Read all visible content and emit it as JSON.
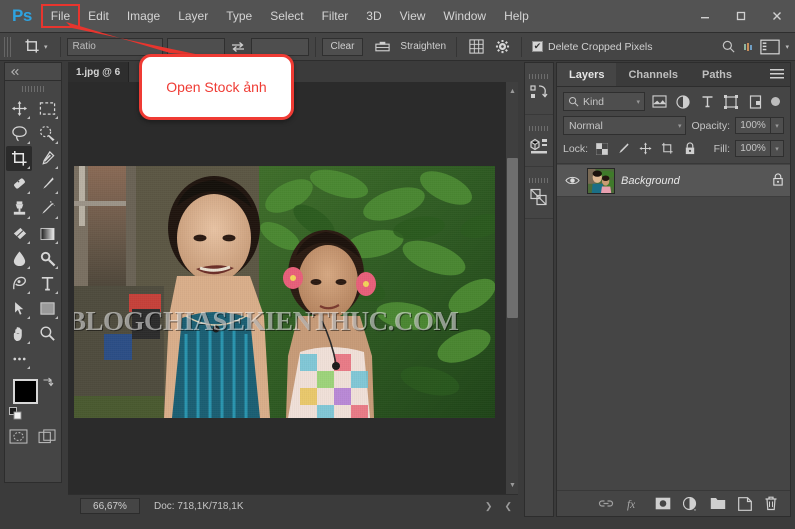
{
  "app": {
    "logo": "Ps",
    "menus": [
      "File",
      "Edit",
      "Image",
      "Layer",
      "Type",
      "Select",
      "Filter",
      "3D",
      "View",
      "Window",
      "Help"
    ],
    "highlighted_menu": "File",
    "window_buttons": [
      "minimize-button",
      "maximize-button",
      "close-button"
    ]
  },
  "options_bar": {
    "tool": "crop-tool",
    "ratio_label": "Ratio",
    "width_value": "",
    "height_value": "",
    "swap_icon": "swap-arrows-icon",
    "resolution_value": "",
    "clear_label": "Clear",
    "straighten_label": "Straighten",
    "overlay_icon": "grid-overlay-icon",
    "settings_icon": "gear-icon",
    "delete_cropped_label": "Delete Cropped Pixels",
    "delete_cropped_checked": true,
    "search_icon": "search-icon",
    "workspace_icon": "workspace-switcher-icon"
  },
  "toolbar": {
    "collapse_icon": "collapse-double-arrow-icon",
    "tools": [
      {
        "name": "move-tool",
        "active": false
      },
      {
        "name": "rectangular-marquee-tool",
        "active": false
      },
      {
        "name": "lasso-tool",
        "active": false
      },
      {
        "name": "quick-selection-tool",
        "active": false
      },
      {
        "name": "crop-tool",
        "active": true
      },
      {
        "name": "eyedropper-tool",
        "active": false
      },
      {
        "name": "spot-healing-brush-tool",
        "active": false
      },
      {
        "name": "brush-tool",
        "active": false
      },
      {
        "name": "clone-stamp-tool",
        "active": false
      },
      {
        "name": "history-brush-tool",
        "active": false
      },
      {
        "name": "eraser-tool",
        "active": false
      },
      {
        "name": "gradient-tool",
        "active": false
      },
      {
        "name": "blur-tool",
        "active": false
      },
      {
        "name": "dodge-tool",
        "active": false
      },
      {
        "name": "pen-tool",
        "active": false
      },
      {
        "name": "horizontal-type-tool",
        "active": false
      },
      {
        "name": "path-selection-tool",
        "active": false
      },
      {
        "name": "rectangle-shape-tool",
        "active": false
      },
      {
        "name": "hand-tool",
        "active": false
      },
      {
        "name": "zoom-tool",
        "active": false
      },
      {
        "name": "edit-toolbar-ellipsis",
        "active": false
      }
    ],
    "foreground_color": "#000000",
    "background_color": "#ffffff",
    "quick_mask_icon": "quick-mask-icon",
    "screen_mode_icon": "screen-mode-icon"
  },
  "document": {
    "tab_label": "1.jpg @ 6",
    "watermark": "BLOGCHIASEKIENTHUC.COM"
  },
  "status_bar": {
    "zoom": "66,67%",
    "doc_info": "Doc: 718,1K/718,1K"
  },
  "panels": {
    "collapsed_icons": [
      "history-panel-icon",
      "3d-panel-icon",
      "layer-comps-panel-icon"
    ],
    "tabs": [
      {
        "label": "Layers",
        "active": true
      },
      {
        "label": "Channels",
        "active": false
      },
      {
        "label": "Paths",
        "active": false
      }
    ],
    "menu_icon": "panel-menu-icon",
    "filter": {
      "kind_label": "Kind",
      "search_icon": "search-icon",
      "icons": [
        "pixel-layer-filter-icon",
        "adjustment-layer-filter-icon",
        "type-layer-filter-icon",
        "shape-layer-filter-icon",
        "smart-object-filter-icon"
      ],
      "toggle_icon": "filter-toggle-icon"
    },
    "blend_mode": "Normal",
    "opacity_label": "Opacity:",
    "opacity_value": "100%",
    "lock_label": "Lock:",
    "lock_icons": [
      "lock-transparent-pixels-icon",
      "lock-image-pixels-icon",
      "lock-position-icon",
      "lock-artboard-icon",
      "lock-all-icon"
    ],
    "fill_label": "Fill:",
    "fill_value": "100%",
    "layers": [
      {
        "name": "Background",
        "visible": true,
        "locked": true
      }
    ],
    "footer_icons": [
      "link-layers-icon",
      "layer-style-fx-icon",
      "add-layer-mask-icon",
      "new-adjustment-layer-icon",
      "new-group-icon",
      "new-layer-icon",
      "delete-layer-icon"
    ]
  },
  "callout": {
    "text": "Open Stock ảnh",
    "color": "#ef3b34"
  },
  "colors": {
    "accent_blue": "#2ea3e0",
    "callout_red": "#ef3b34",
    "panel_bg": "#454545",
    "menu_bg": "#535353",
    "canvas_bg": "#2b2b2b"
  }
}
